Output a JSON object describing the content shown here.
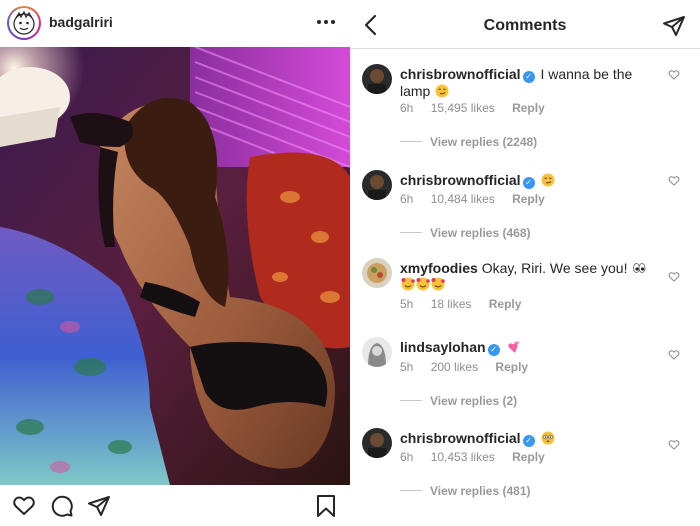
{
  "post": {
    "username": "badgalriri",
    "more_icon": "more-horizontal-icon",
    "actions": [
      "heart-icon",
      "comment-icon",
      "share-icon",
      "bookmark-icon"
    ]
  },
  "comments_panel": {
    "title": "Comments",
    "back_icon": "chevron-left-icon",
    "send_icon": "direct-send-icon",
    "items": [
      {
        "username": "chrisbrownofficial",
        "verified": true,
        "text": "I wanna be the lamp",
        "emoji": "smirking-face",
        "time": "6h",
        "likes": "15,495 likes",
        "reply": "Reply",
        "view_replies": "View replies (2248)"
      },
      {
        "username": "chrisbrownofficial",
        "verified": true,
        "text": "",
        "emoji": "smirking-face",
        "time": "6h",
        "likes": "10,484 likes",
        "reply": "Reply",
        "view_replies": "View replies (468)"
      },
      {
        "username": "xmyfoodies",
        "verified": false,
        "text": "Okay, Riri. We see you!",
        "emoji": "eyes, smiling-face-with-hearts x3",
        "time": "5h",
        "likes": "18 likes",
        "reply": "Reply",
        "view_replies": ""
      },
      {
        "username": "lindsaylohan",
        "verified": true,
        "text": "",
        "emoji": "two-hearts",
        "time": "5h",
        "likes": "200 likes",
        "reply": "Reply",
        "view_replies": "View replies (2)"
      },
      {
        "username": "chrisbrownofficial",
        "verified": true,
        "text": "",
        "emoji": "flushed-face",
        "time": "6h",
        "likes": "10,453 likes",
        "reply": "Reply",
        "view_replies": "View replies (481)"
      }
    ]
  },
  "colors": {
    "accent_blue": "#3897f0",
    "meta_gray": "#8e8e8e",
    "text": "#262626",
    "border": "#dbdbdb"
  }
}
